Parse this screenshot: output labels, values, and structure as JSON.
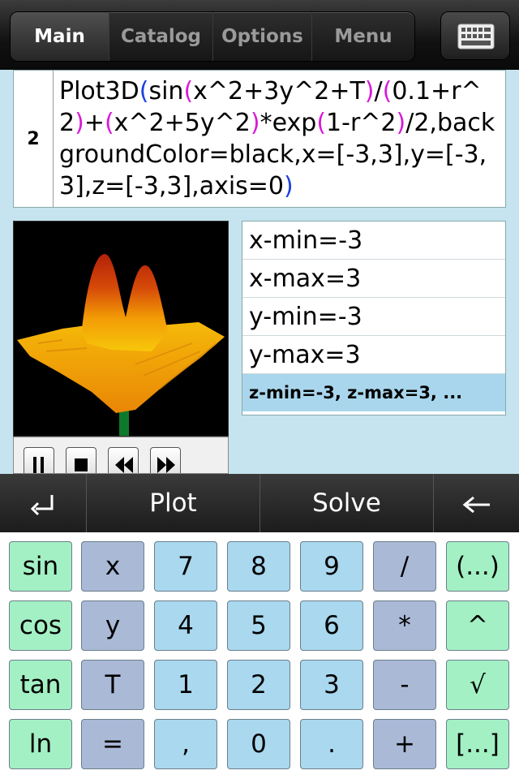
{
  "tabs": [
    {
      "label": "Main",
      "active": true
    },
    {
      "label": "Catalog",
      "active": false
    },
    {
      "label": "Options",
      "active": false
    },
    {
      "label": "Menu",
      "active": false
    }
  ],
  "keyboard_button_icon": "keyboard-icon",
  "expression": {
    "number": "2",
    "parts": [
      {
        "t": "Plot3D",
        "c": "k"
      },
      {
        "t": "(",
        "c": "b"
      },
      {
        "t": "sin",
        "c": "k"
      },
      {
        "t": "(",
        "c": "m"
      },
      {
        "t": "x^2+3y^2+T",
        "c": "k"
      },
      {
        "t": ")",
        "c": "m"
      },
      {
        "t": "/",
        "c": "k"
      },
      {
        "t": "(",
        "c": "m"
      },
      {
        "t": "0.1+r^2",
        "c": "k"
      },
      {
        "t": ")",
        "c": "m"
      },
      {
        "t": "+",
        "c": "k"
      },
      {
        "t": "(",
        "c": "m"
      },
      {
        "t": "x^2+5y^2",
        "c": "k"
      },
      {
        "t": ")",
        "c": "m"
      },
      {
        "t": "*exp",
        "c": "k"
      },
      {
        "t": "(",
        "c": "m"
      },
      {
        "t": "1-r^2",
        "c": "k"
      },
      {
        "t": ")",
        "c": "m"
      },
      {
        "t": "/2,backgroundColor=black,x=[-3,3],y=[-3,3],z=[-3,3],axis=0",
        "c": "k"
      },
      {
        "t": ")",
        "c": "b"
      }
    ]
  },
  "params": [
    "x-min=-3",
    "x-max=3",
    "y-min=-3",
    "y-max=3",
    "z-min=-3, z-max=3, ..."
  ],
  "anim_controls": [
    "pause-icon",
    "stop-icon",
    "rewind-icon",
    "fast-forward-icon"
  ],
  "actions": {
    "enter": "↵",
    "plot": "Plot",
    "solve": "Solve",
    "back": "←"
  },
  "keys": [
    [
      "sin",
      "x",
      "7",
      "8",
      "9",
      "/",
      "(...)"
    ],
    [
      "cos",
      "y",
      "4",
      "5",
      "6",
      "*",
      "^"
    ],
    [
      "tan",
      "T",
      "1",
      "2",
      "3",
      "-",
      "√"
    ],
    [
      "ln",
      "=",
      ",",
      "0",
      ".",
      "+",
      "[...]"
    ]
  ],
  "colors": {
    "bracket_blue": "#1a3fe0",
    "bracket_magenta": "#d81ad8",
    "key_green": "#a3f0c4",
    "key_slate": "#a9b9d6",
    "key_blue": "#a9d8ef"
  }
}
